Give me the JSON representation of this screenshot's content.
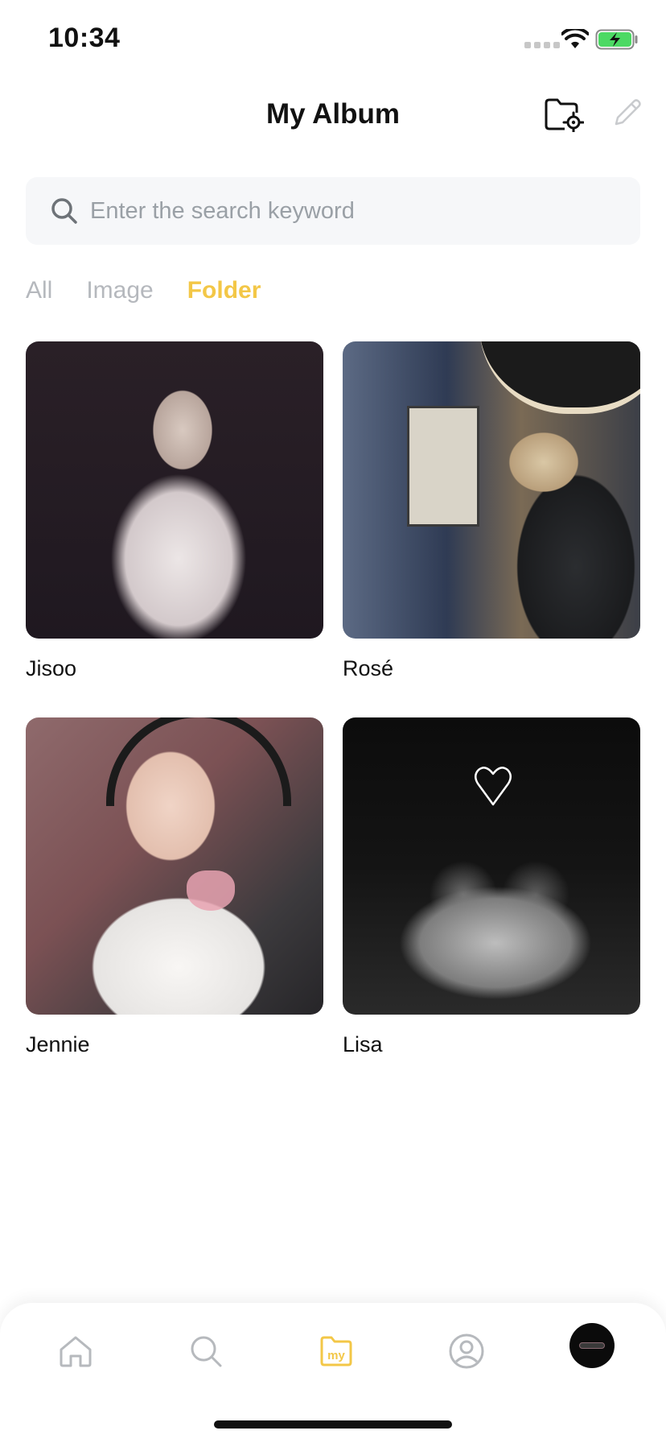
{
  "status_bar": {
    "time": "10:34"
  },
  "header": {
    "title": "My Album",
    "folder_settings_icon": "folder-gear-icon",
    "edit_icon": "pencil-icon"
  },
  "search": {
    "placeholder": "Enter the search keyword",
    "value": ""
  },
  "tabs": [
    {
      "label": "All",
      "active": false
    },
    {
      "label": "Image",
      "active": false
    },
    {
      "label": "Folder",
      "active": true
    }
  ],
  "folders": [
    {
      "label": "Jisoo"
    },
    {
      "label": "Rosé"
    },
    {
      "label": "Jennie"
    },
    {
      "label": "Lisa"
    }
  ],
  "bottom_nav": [
    {
      "icon": "home-icon"
    },
    {
      "icon": "search-icon"
    },
    {
      "icon": "my-folder-icon",
      "active": true
    },
    {
      "icon": "profile-icon"
    },
    {
      "icon": "avatar"
    }
  ],
  "colors": {
    "accent": "#f3c747",
    "inactive_tab": "#b5b8bd",
    "search_bg": "#f6f7f9"
  }
}
